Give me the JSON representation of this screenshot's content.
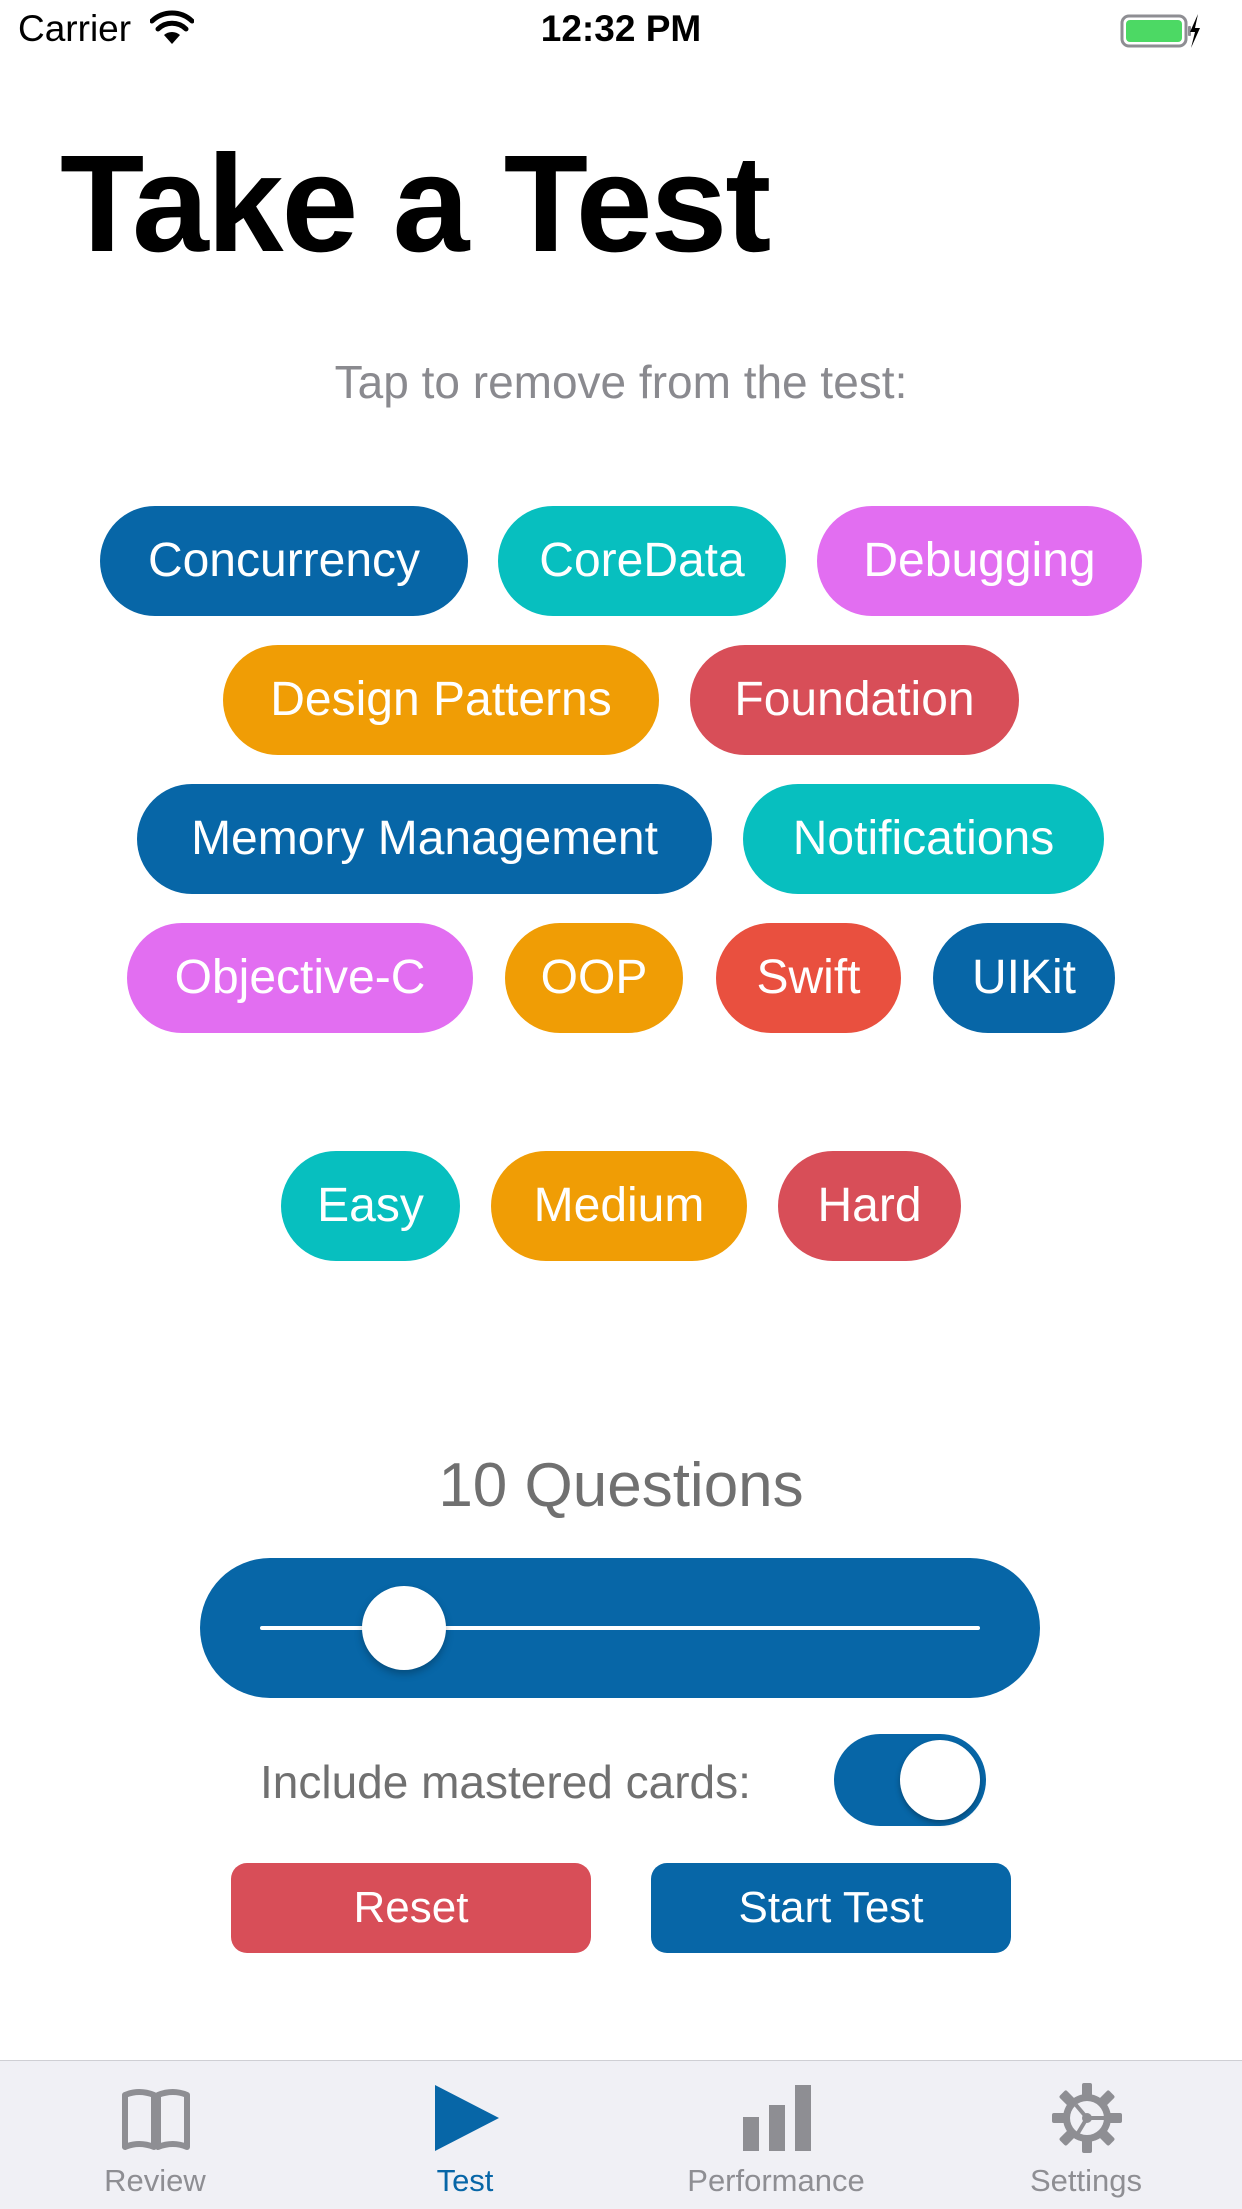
{
  "status_bar": {
    "carrier": "Carrier",
    "time": "12:32 PM"
  },
  "title": "Take a Test",
  "subtitle": "Tap to remove from the test:",
  "topics": [
    {
      "label": "Concurrency",
      "color": "#0766a7"
    },
    {
      "label": "CoreData",
      "color": "#07bfbf"
    },
    {
      "label": "Debugging",
      "color": "#e26ef1"
    },
    {
      "label": "Design Patterns",
      "color": "#f09d05"
    },
    {
      "label": "Foundation",
      "color": "#d84e58"
    },
    {
      "label": "Memory Management",
      "color": "#0766a7"
    },
    {
      "label": "Notifications",
      "color": "#07bfbf"
    },
    {
      "label": "Objective-C",
      "color": "#e26ef1"
    },
    {
      "label": "OOP",
      "color": "#f09d05"
    },
    {
      "label": "Swift",
      "color": "#e9503f"
    },
    {
      "label": "UIKit",
      "color": "#0766a7"
    }
  ],
  "difficulties": [
    {
      "label": "Easy",
      "color": "#07bfbf"
    },
    {
      "label": "Medium",
      "color": "#f09d05"
    },
    {
      "label": "Hard",
      "color": "#d84e58"
    }
  ],
  "question_count_label": "10 Questions",
  "slider": {
    "value": 0.2
  },
  "mastered": {
    "label": "Include mastered cards:",
    "on": true
  },
  "buttons": {
    "reset": "Reset",
    "start": "Start Test"
  },
  "tabs": [
    {
      "label": "Review",
      "icon": "book-icon",
      "active": false
    },
    {
      "label": "Test",
      "icon": "play-icon",
      "active": true
    },
    {
      "label": "Performance",
      "icon": "bar-chart-icon",
      "active": false
    },
    {
      "label": "Settings",
      "icon": "gear-icon",
      "active": false
    }
  ],
  "colors": {
    "accent": "#0766a7",
    "inactive_tab": "#8e8e93"
  }
}
